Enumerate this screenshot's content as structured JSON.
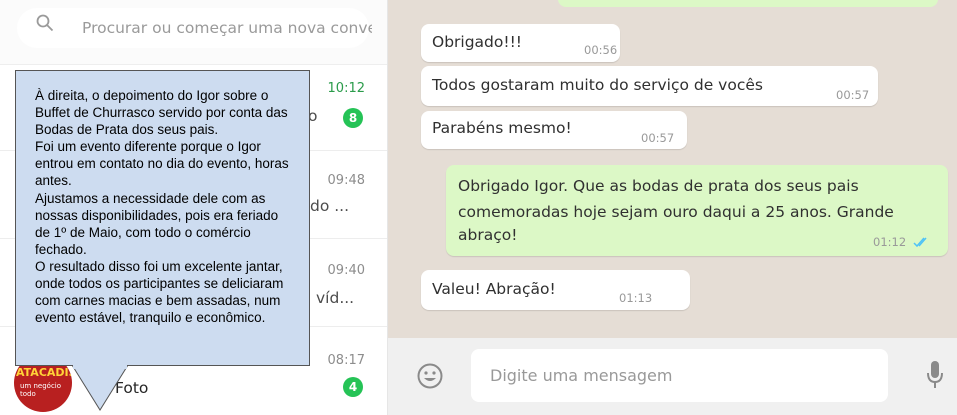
{
  "search": {
    "placeholder": "Procurar ou começar uma nova conve..."
  },
  "chats": [
    {
      "time": "10:12",
      "preview": "o",
      "badge": "8"
    },
    {
      "time": "09:48",
      "preview": "do ..."
    },
    {
      "time": "09:40",
      "preview": "víd..."
    },
    {
      "time": "08:17",
      "preview": "Foto",
      "badge": "4",
      "avatar_text": "ATACADISTA",
      "avatar_sub": "um negócio todo"
    }
  ],
  "callout": {
    "paragraphs": [
      "À direita, o depoimento do Igor sobre o Buffet de Churrasco servido por conta das Bodas de Prata dos seus pais.",
      "Foi um evento diferente porque o Igor entrou em contato no dia do evento, horas antes.",
      "Ajustamos a necessidade dele com as nossas disponibilidades, pois era feriado de 1º de Maio, com todo o comércio fechado.",
      "O resultado disso foi um excelente jantar, onde todos os participantes se deliciaram com carnes macias e bem assadas, num evento estável, tranquilo e econômico."
    ]
  },
  "messages": [
    {
      "text": "Obrigado!!!",
      "time": "00:56"
    },
    {
      "text": "Todos gostaram muito do serviço de vocês",
      "time": "00:57"
    },
    {
      "text": "Parabéns mesmo!",
      "time": "00:57"
    },
    {
      "text": "Obrigado Igor. Que as bodas de prata dos seus pais comemoradas hoje sejam ouro daqui a 25 anos. Grande abraço!",
      "line1": "Obrigado Igor. Que as bodas de prata dos seus pais",
      "line2": "comemoradas hoje sejam ouro daqui a 25 anos. Grande",
      "line3": "abraço!",
      "time": "01:12"
    },
    {
      "text": "Valeu! Abração!",
      "time": "01:13"
    }
  ],
  "composer": {
    "placeholder": "Digite uma mensagem"
  },
  "colors": {
    "outgoing_bubble": "#dcf8c6",
    "chat_bg": "#e5ddd5",
    "badge": "#25c356",
    "read_ticks": "#4fc3f7",
    "callout_bg": "#cddcf0"
  }
}
